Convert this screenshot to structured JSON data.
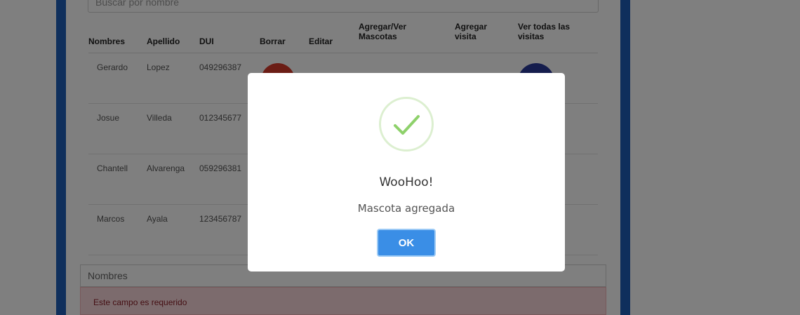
{
  "search": {
    "placeholder": "Buscar por nombre"
  },
  "table": {
    "headers": {
      "nombres": "Nombres",
      "apellido": "Apellido",
      "dui": "DUI",
      "borrar": "Borrar",
      "editar": "Editar",
      "mascotas_line1": "Agregar/Ver",
      "mascotas_line2": "Mascotas",
      "visita_line1": "Agregar",
      "visita_line2": "visita",
      "visitas_line1": "Ver todas las",
      "visitas_line2": "visitas"
    },
    "rows": [
      {
        "nombre": "Gerardo",
        "apellido": "Lopez",
        "dui": "049296387"
      },
      {
        "nombre": "Josue",
        "apellido": "Villeda",
        "dui": "012345677"
      },
      {
        "nombre": "Chantell",
        "apellido": "Alvarenga",
        "dui": "059296381"
      },
      {
        "nombre": "Marcos",
        "apellido": "Ayala",
        "dui": "123456787"
      }
    ]
  },
  "form": {
    "nombres_label": "Nombres",
    "error": "Este campo es requerido"
  },
  "alert": {
    "icon": "success-check-icon",
    "title": "WooHoo!",
    "text": "Mascota agregada",
    "ok_label": "OK"
  },
  "colors": {
    "accent_blue": "#1f5fb8",
    "ok_button": "#3a8ee6",
    "check_green": "#8ed16b",
    "delete_red": "#d63a2b",
    "visits_navy": "#2a3a9a"
  }
}
